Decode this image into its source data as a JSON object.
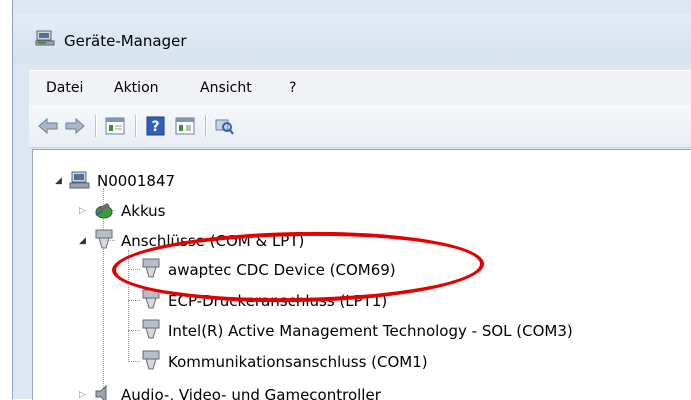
{
  "window": {
    "title": "Geräte-Manager"
  },
  "menu": [
    "Datei",
    "Aktion",
    "Ansicht",
    "?"
  ],
  "toolbar": [
    {
      "icon": "back-arrow-icon"
    },
    {
      "icon": "forward-arrow-icon"
    },
    {
      "icon": "properties-icon"
    },
    {
      "icon": "help-icon"
    },
    {
      "icon": "update-driver-icon"
    },
    {
      "icon": "scan-hardware-icon"
    }
  ],
  "tree": {
    "root": "N0001847",
    "akkus": "Akkus",
    "anschluesse": "Anschlüsse (COM & LPT)",
    "items": [
      "awaptec CDC Device (COM69)",
      "ECP-Druckeranschluss (LPT1)",
      "Intel(R) Active Management Technology - SOL (COM3)",
      "Kommunikationsanschluss (COM1)"
    ],
    "audio": "Audio-, Video- und Gamecontroller"
  },
  "annotation": {
    "color": "#e50000"
  }
}
